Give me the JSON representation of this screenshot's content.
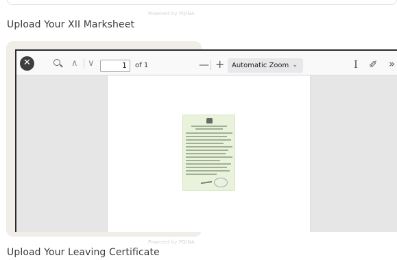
{
  "powered_by": "Powered by PQINA",
  "sections": {
    "marksheet_title": "Upload Your XII Marksheet",
    "leaving_title": "Upload Your Leaving Certificate"
  },
  "viewer": {
    "page_number": "1",
    "page_of": "of 1",
    "zoom_out": "—",
    "zoom_in": "+",
    "zoom_label": "Automatic Zoom",
    "zoom_chevron": "⌄",
    "prev": "∧",
    "next": "∨",
    "text_cursor": "I",
    "draw": "✐",
    "more": "»"
  },
  "close_label": "✕"
}
